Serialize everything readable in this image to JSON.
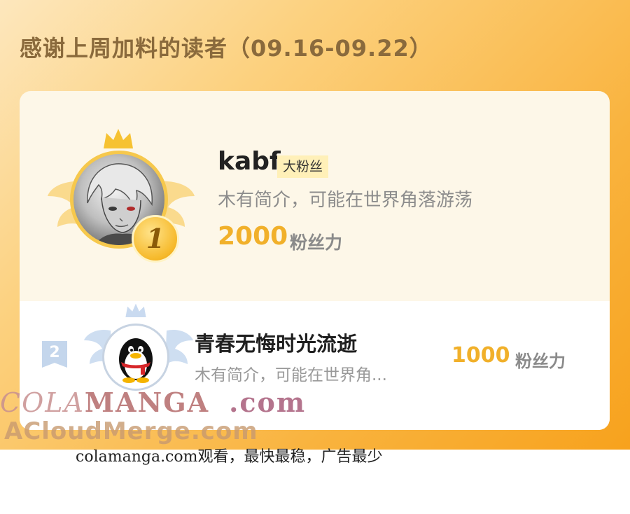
{
  "heading": "感谢上周加料的读者（09.16-09.22）",
  "leaders": [
    {
      "rank": "1",
      "name": "kabf",
      "tag": "大粉丝",
      "description": "木有简介，可能在世界角落游荡",
      "score": "2000",
      "unit": "粉丝力"
    },
    {
      "rank": "2",
      "name": "青春无悔时光流逝",
      "description": "木有简介，可能在世界角...",
      "score": "1000",
      "unit": "粉丝力"
    }
  ],
  "watermark": {
    "brand_light": "COLA",
    "brand_bold": "MANGA",
    "domain": ".com",
    "secondary": "ACloudMerge.com"
  },
  "footer": "colamanga.com观看，最快最稳，广告最少",
  "icons": [
    "crown-icon",
    "wings-icon",
    "penguin-avatar",
    "rank-ribbon-icon"
  ],
  "colors": {
    "accent_gold": "#f1b02a",
    "banner_orange": "#f7a21d",
    "tag_bg": "#fff0b8"
  }
}
